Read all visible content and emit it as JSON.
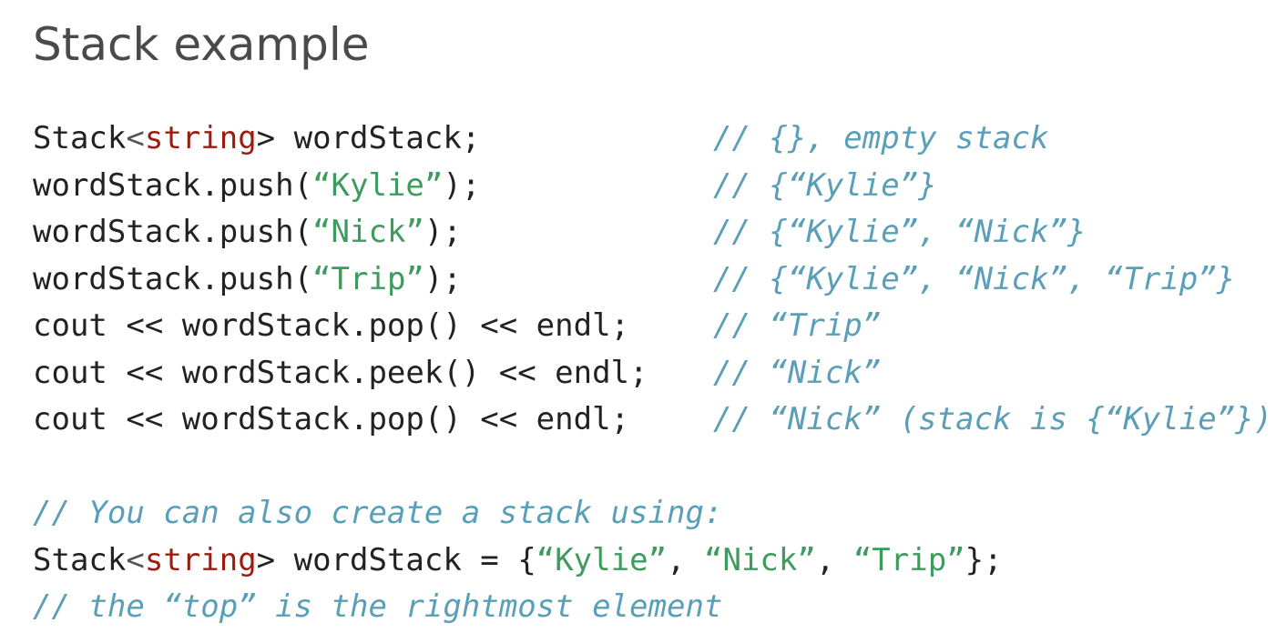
{
  "title": "Stack example",
  "code": {
    "l1": {
      "a": "Stack",
      "b": "<",
      "type": "string",
      "c": "> wordStack;",
      "comment": "// {}, empty stack"
    },
    "l2": {
      "a": "wordStack.push(",
      "q1": "“",
      "str": "Kylie",
      "q2": "”",
      "b": ");",
      "comment": "// {“Kylie”}"
    },
    "l3": {
      "a": "wordStack.push(",
      "q1": "“",
      "str": "Nick",
      "q2": "”",
      "b": ");",
      "comment": "// {“Kylie”, “Nick”}"
    },
    "l4": {
      "a": "wordStack.push(",
      "q1": "“",
      "str": "Trip",
      "q2": "”",
      "b": ");",
      "comment": "// {“Kylie”, “Nick”, “Trip”}"
    },
    "l5": {
      "a": "cout << wordStack.pop() << endl;",
      "comment": "// “Trip”"
    },
    "l6": {
      "a": "cout << wordStack.peek() << endl;",
      "comment": "// “Nick”"
    },
    "l7": {
      "a": "cout << wordStack.pop() << endl;",
      "comment": "// “Nick” (stack is {“Kylie”})"
    },
    "l9": {
      "comment": "// You can also create a stack using:"
    },
    "l10": {
      "a": "Stack",
      "b": "<",
      "type": "string",
      "c": "> wordStack = {",
      "q1": "“",
      "s1": "Kylie",
      "q2": "”",
      "sep1": ", ",
      "q3": "“",
      "s2": "Nick",
      "q4": "”",
      "sep2": ", ",
      "q5": "“",
      "s3": "Trip",
      "q6": "”",
      "end": "};"
    },
    "l11": {
      "comment": "// the “top” is the rightmost element"
    }
  }
}
